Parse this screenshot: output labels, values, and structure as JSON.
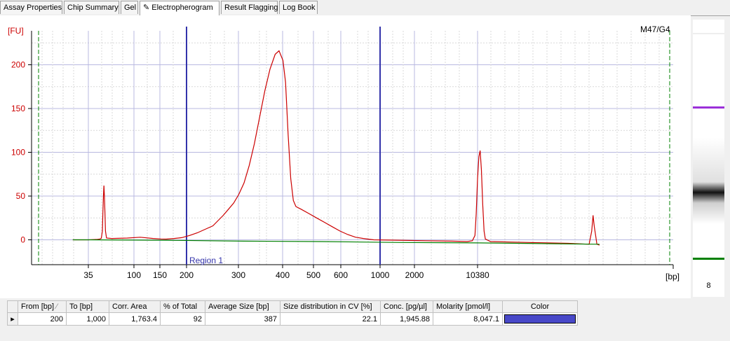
{
  "tabs": [
    {
      "label": "Assay Properties",
      "active": false
    },
    {
      "label": "Chip Summary",
      "active": false
    },
    {
      "label": "Gel",
      "active": false
    },
    {
      "label": "Electropherogram",
      "active": true
    },
    {
      "label": "Result Flagging",
      "active": false
    },
    {
      "label": "Log Book",
      "active": false
    }
  ],
  "electropherogram": {
    "sample_label": "M47/G4",
    "y_unit_label": "[FU]",
    "x_unit_label": "[bp]",
    "region_label": "Region 1"
  },
  "chart_data": {
    "type": "line",
    "title": "",
    "xlabel": "[bp]",
    "ylabel": "[FU]",
    "ylim": [
      -30,
      240
    ],
    "yticks": [
      0,
      50,
      100,
      150,
      200
    ],
    "xtick_labels": [
      "35",
      "100",
      "150",
      "200",
      "300",
      "400",
      "500",
      "600",
      "1000",
      "2000",
      "10380"
    ],
    "grid": true,
    "region": {
      "from_bp": 200,
      "to_bp": 1000,
      "label": "Region 1"
    },
    "series": [
      {
        "color": "#cc0000",
        "points": [
          [
            -0.06,
            0
          ],
          [
            0.0,
            0
          ],
          [
            0.0,
            0
          ],
          [
            0.035,
            0.5
          ],
          [
            0.045,
            1
          ],
          [
            0.05,
            2
          ],
          [
            0.054,
            10
          ],
          [
            0.056,
            30
          ],
          [
            0.058,
            50
          ],
          [
            0.06,
            62
          ],
          [
            0.062,
            50
          ],
          [
            0.064,
            30
          ],
          [
            0.066,
            10
          ],
          [
            0.07,
            2
          ],
          [
            0.09,
            1.5
          ],
          [
            0.15,
            2
          ],
          [
            0.2,
            3
          ],
          [
            0.25,
            1.5
          ],
          [
            0.28,
            1
          ],
          [
            0.3,
            0.8
          ],
          [
            0.33,
            1.5
          ],
          [
            0.36,
            2.5
          ],
          [
            0.39,
            5
          ],
          [
            0.42,
            8
          ],
          [
            0.45,
            12
          ],
          [
            0.48,
            16
          ],
          [
            0.5,
            22
          ],
          [
            0.52,
            28
          ],
          [
            0.54,
            35
          ],
          [
            0.56,
            42
          ],
          [
            0.58,
            52
          ],
          [
            0.6,
            65
          ],
          [
            0.62,
            85
          ],
          [
            0.64,
            110
          ],
          [
            0.66,
            140
          ],
          [
            0.68,
            170
          ],
          [
            0.7,
            195
          ],
          [
            0.72,
            212
          ],
          [
            0.735,
            216
          ],
          [
            0.75,
            205
          ],
          [
            0.76,
            180
          ],
          [
            0.77,
            120
          ],
          [
            0.78,
            70
          ],
          [
            0.79,
            45
          ],
          [
            0.8,
            38
          ],
          [
            0.82,
            35
          ],
          [
            0.85,
            30
          ],
          [
            0.88,
            25
          ],
          [
            0.91,
            20
          ],
          [
            0.94,
            15
          ],
          [
            0.97,
            10
          ],
          [
            1.0,
            6
          ],
          [
            1.03,
            3
          ],
          [
            1.06,
            1.5
          ],
          [
            1.1,
            0
          ],
          [
            1.2,
            -0.5
          ],
          [
            1.3,
            -1
          ],
          [
            1.4,
            -1.5
          ],
          [
            1.46,
            -2
          ],
          [
            1.48,
            -1
          ],
          [
            1.49,
            5
          ],
          [
            1.495,
            30
          ],
          [
            1.5,
            70
          ],
          [
            1.505,
            95
          ],
          [
            1.51,
            102
          ],
          [
            1.515,
            80
          ],
          [
            1.52,
            40
          ],
          [
            1.525,
            10
          ],
          [
            1.53,
            1
          ],
          [
            1.55,
            -2
          ],
          [
            1.7,
            -3
          ],
          [
            1.85,
            -4
          ],
          [
            1.93,
            -5
          ],
          [
            1.94,
            10
          ],
          [
            1.945,
            28
          ],
          [
            1.95,
            15
          ],
          [
            1.955,
            5
          ],
          [
            1.96,
            -5
          ],
          [
            1.97,
            -6
          ]
        ]
      },
      {
        "color": "#008000",
        "points": [
          [
            -0.06,
            0
          ],
          [
            0.0,
            0
          ],
          [
            0.3,
            -0.5
          ],
          [
            0.6,
            -1.5
          ],
          [
            0.9,
            -2
          ],
          [
            1.2,
            -3
          ],
          [
            1.5,
            -3.5
          ],
          [
            1.8,
            -4.5
          ],
          [
            1.97,
            -5
          ]
        ]
      }
    ],
    "gel": {
      "sample_number": "8",
      "upper_marker_color": "#9b30d9",
      "lower_marker_color": "#008000"
    }
  },
  "table": {
    "headers": [
      "From [bp]",
      "To [bp]",
      "Corr. Area",
      "% of Total",
      "Average Size [bp]",
      "Size distribution in CV [%]",
      "Conc. [pg/µl]",
      "Molarity [pmol/l]",
      "Color"
    ],
    "rows": [
      {
        "from": "200",
        "to": "1,000",
        "corr_area": "1,763.4",
        "pct_total": "92",
        "avg_size": "387",
        "cv": "22.1",
        "conc": "1,945.88",
        "molarity": "8,047.1",
        "color": "#4848c8"
      }
    ]
  }
}
